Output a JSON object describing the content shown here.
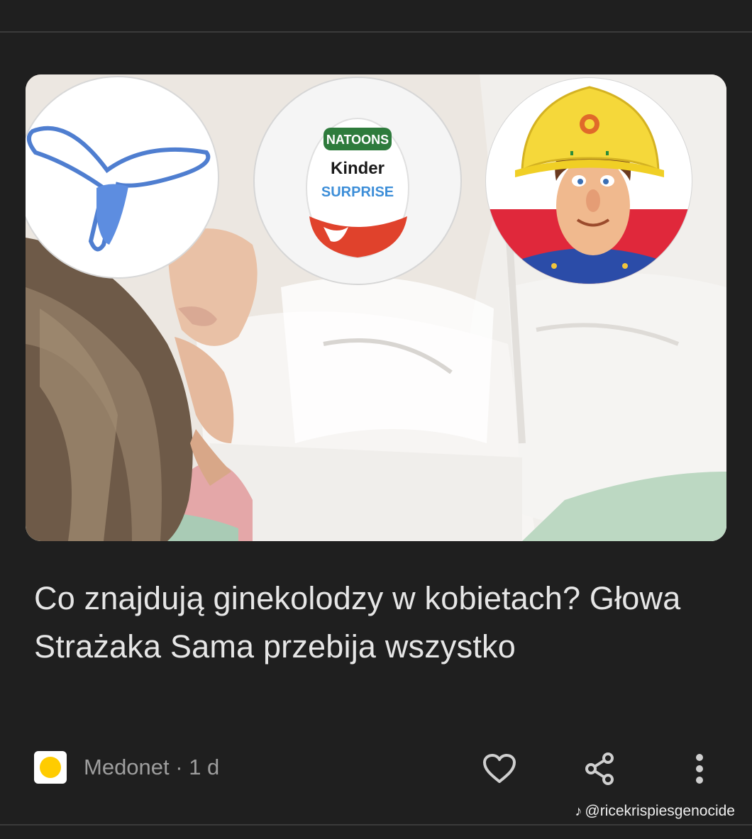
{
  "article": {
    "headline": "Co znajdują ginekolodzy w kobietach? Głowa Strażaka Sama przebija wszystko",
    "source": "Medonet",
    "separator": " · ",
    "age": "1 d"
  },
  "image": {
    "egg_brand": "Kinder",
    "egg_top": "NATOONS",
    "egg_bottom": "SURPRISE"
  },
  "actions": {
    "like_icon": "heart-icon",
    "share_icon": "share-icon",
    "more_icon": "more-vert-icon"
  },
  "watermark": {
    "handle": "@ricekrispiesgenocide",
    "icon": "tiktok-icon"
  },
  "colors": {
    "background": "#1f1f1f",
    "headline": "#e6e6e6",
    "meta": "#9e9e9e",
    "favicon_dot": "#ffcc00"
  }
}
